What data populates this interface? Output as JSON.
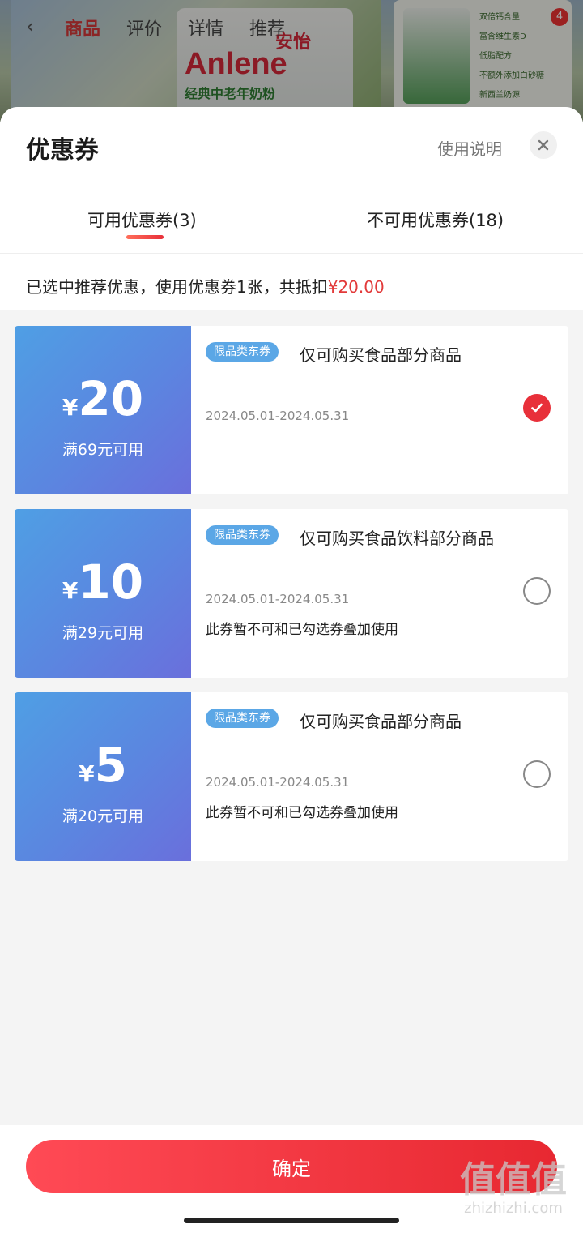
{
  "background_page": {
    "nav_tabs": [
      "商品",
      "评价",
      "详情",
      "推荐"
    ],
    "brand": "Anlene",
    "brand_cn": "安怡",
    "subtitle": "经典中老年奶粉",
    "cart_badge": "4",
    "side_features": [
      "双倍钙含量",
      "富含维生素D",
      "低脂配方",
      "不额外添加白砂糖",
      "新西兰奶源"
    ]
  },
  "sheet": {
    "title": "优惠券",
    "usage_link": "使用说明",
    "close_icon": "close-icon"
  },
  "tabs": [
    {
      "label": "可用优惠券(3)",
      "active": true
    },
    {
      "label": "不可用优惠券(18)",
      "active": false
    }
  ],
  "summary": {
    "text": "已选中推荐优惠，使用优惠券1张，共抵扣",
    "amount": "¥20.00"
  },
  "coupons": [
    {
      "currency": "¥",
      "value": "20",
      "condition": "满69元可用",
      "tag": "限品类东券",
      "desc": "仅可购买食品部分商品",
      "date": "2024.05.01-2024.05.31",
      "note": "",
      "checked": true
    },
    {
      "currency": "¥",
      "value": "10",
      "condition": "满29元可用",
      "tag": "限品类东券",
      "desc": "仅可购买食品饮料部分商品",
      "date": "2024.05.01-2024.05.31",
      "note": "此券暂不可和已勾选券叠加使用",
      "checked": false
    },
    {
      "currency": "¥",
      "value": "5",
      "condition": "满20元可用",
      "tag": "限品类东券",
      "desc": "仅可购买食品部分商品",
      "date": "2024.05.01-2024.05.31",
      "note": "此券暂不可和已勾选券叠加使用",
      "checked": false
    }
  ],
  "confirm_button": "确定",
  "watermark": {
    "big": "值值值",
    "small": "zhizhizhi.com"
  },
  "colors": {
    "accent": "#e8303a",
    "coupon_blue": "#5b86e0",
    "tag_blue": "#5ba7e6"
  }
}
